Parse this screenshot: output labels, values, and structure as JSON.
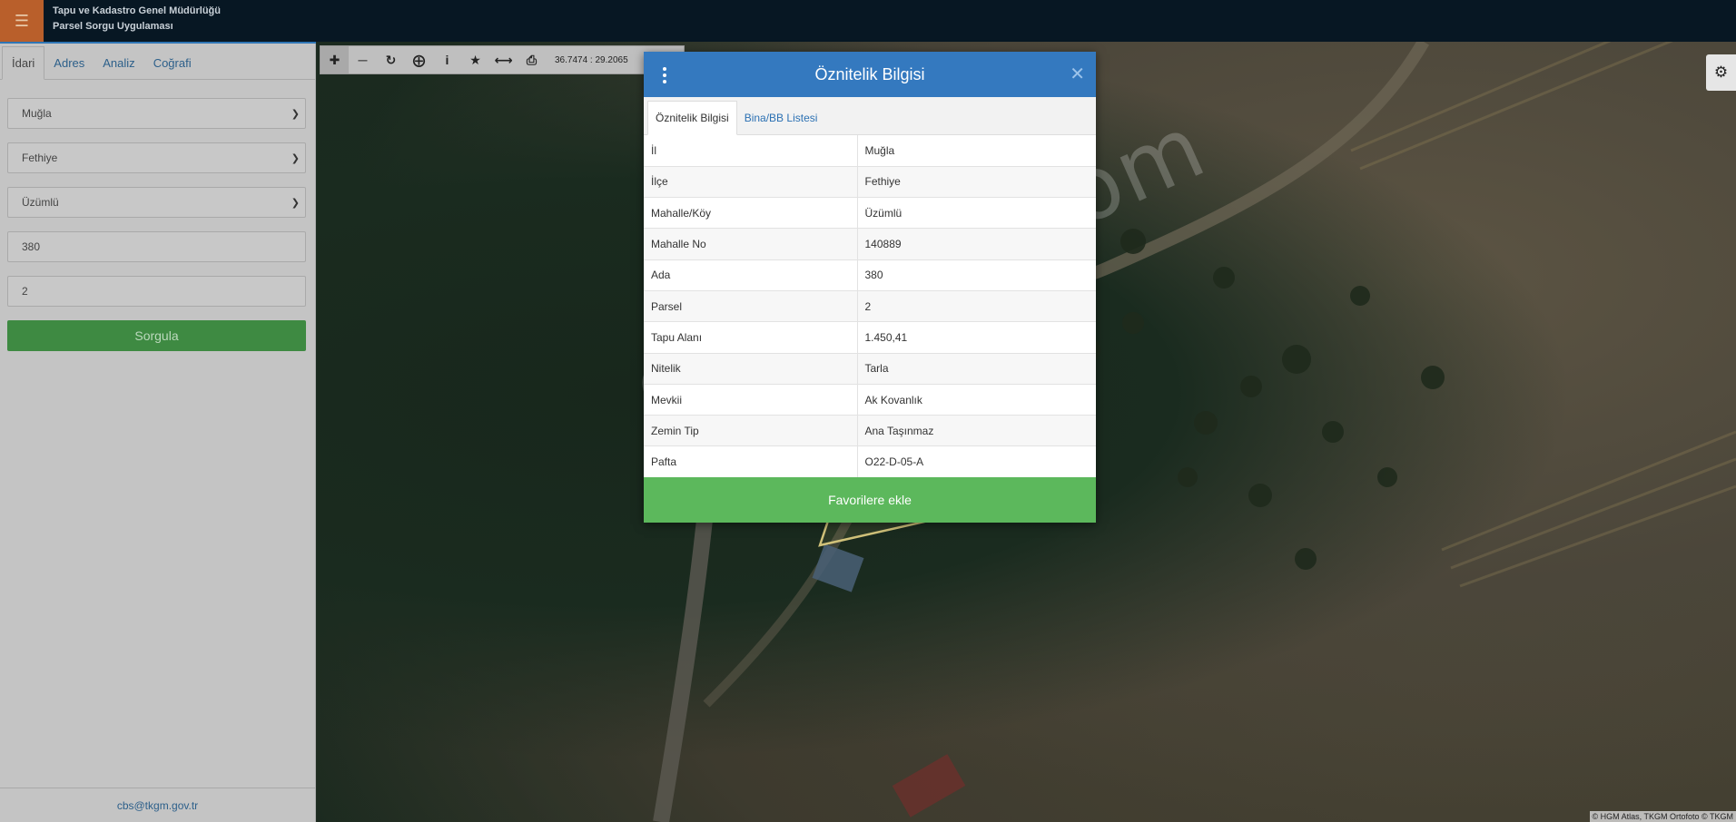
{
  "header": {
    "menu_icon": "hamburger-icon",
    "title_line1": "Tapu ve Kadastro Genel Müdürlüğü",
    "title_line2": "Parsel Sorgu Uygulaması"
  },
  "left_panel": {
    "tabs": [
      {
        "label": "İdari",
        "active": true
      },
      {
        "label": "Adres",
        "active": false
      },
      {
        "label": "Analiz",
        "active": false
      },
      {
        "label": "Coğrafi",
        "active": false
      }
    ],
    "fields": {
      "il": "Muğla",
      "ilce": "Fethiye",
      "mahalle": "Üzümlü",
      "ada": "380",
      "parsel": "2"
    },
    "submit_label": "Sorgula",
    "footer_email": "cbs@tkgm.gov.tr"
  },
  "map": {
    "toolbar_icons": [
      "plus-icon",
      "minus-icon",
      "refresh-icon",
      "crosshair-icon",
      "info-icon",
      "star-icon",
      "measure-icon",
      "print-icon"
    ],
    "coordinates": "36.7474 : 29.2065",
    "attribution": "© HGM Atlas, TKGM Ortofoto © TKGM",
    "watermark": "emlakjet.com",
    "parcel_color": "#d1c27a"
  },
  "modal": {
    "title": "Öznitelik Bilgisi",
    "tabs": [
      {
        "label": "Öznitelik Bilgisi",
        "active": true
      },
      {
        "label": "Bina/BB Listesi",
        "active": false
      }
    ],
    "rows": [
      {
        "key": "İl",
        "value": "Muğla"
      },
      {
        "key": "İlçe",
        "value": "Fethiye"
      },
      {
        "key": "Mahalle/Köy",
        "value": "Üzümlü"
      },
      {
        "key": "Mahalle No",
        "value": "140889"
      },
      {
        "key": "Ada",
        "value": "380"
      },
      {
        "key": "Parsel",
        "value": "2"
      },
      {
        "key": "Tapu Alanı",
        "value": "1.450,41"
      },
      {
        "key": "Nitelik",
        "value": "Tarla"
      },
      {
        "key": "Mevkii",
        "value": "Ak Kovanlık"
      },
      {
        "key": "Zemin Tip",
        "value": "Ana Taşınmaz"
      },
      {
        "key": "Pafta",
        "value": "O22-D-05-A"
      }
    ],
    "favorite_label": "Favorilere ekle",
    "header_color": "#3479bf",
    "button_color": "#5cb85c"
  }
}
